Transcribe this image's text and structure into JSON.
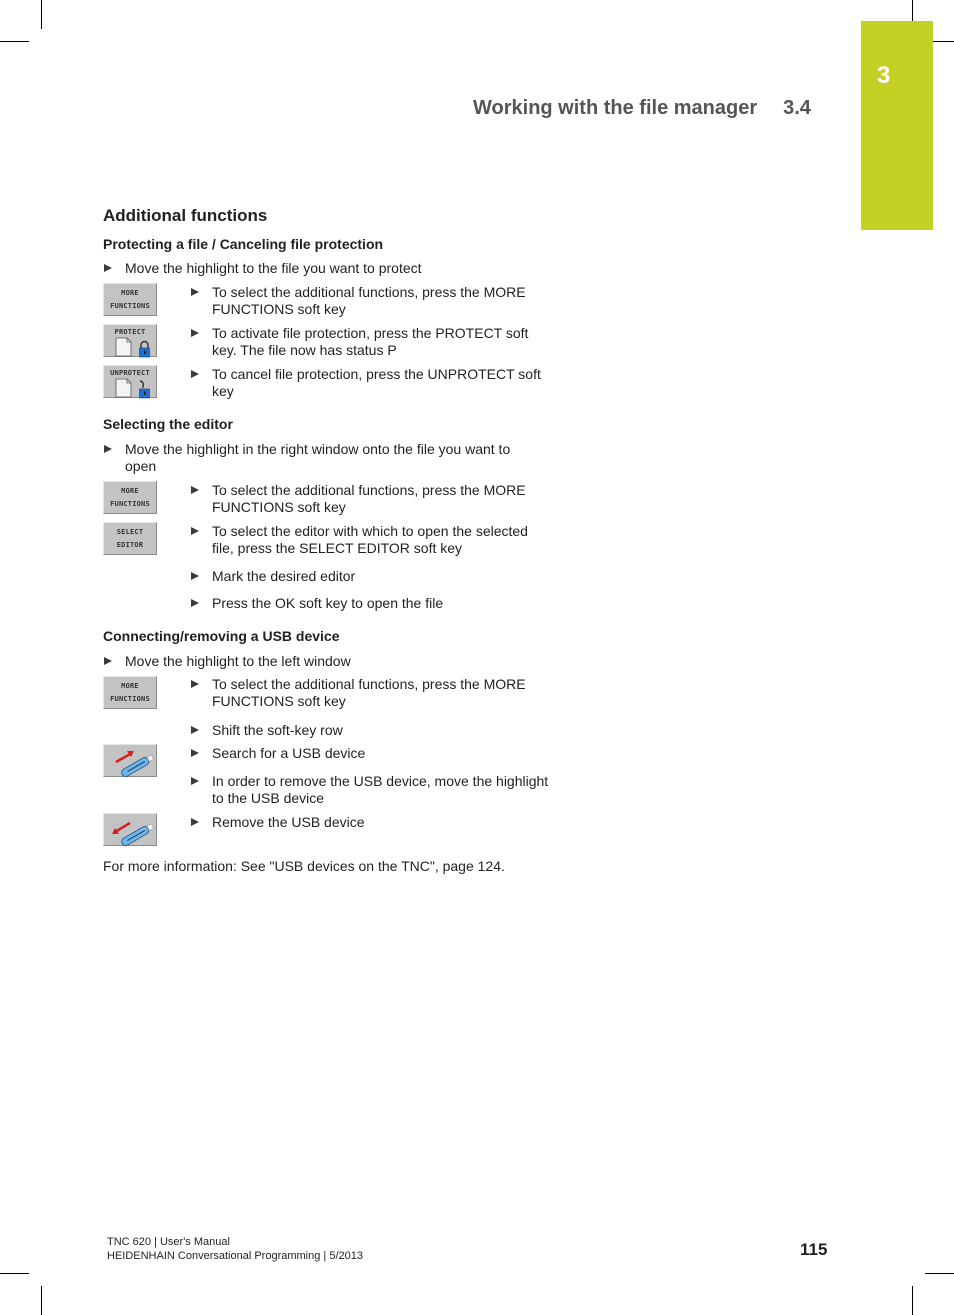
{
  "chapter_tab": {
    "number": "3",
    "color": "#c5d024"
  },
  "running_header": {
    "title": "Working with the file manager",
    "section": "3.4"
  },
  "section_title": "Additional functions",
  "protect": {
    "heading": "Protecting a file / Canceling file protection",
    "intro": "Move the highlight to the file you want to protect",
    "steps": [
      {
        "softkey": {
          "line1": "MORE",
          "line2": "FUNCTIONS"
        },
        "text": "To select the additional functions, press the MORE FUNCTIONS soft key"
      },
      {
        "softkey": {
          "line1": "PROTECT",
          "icon": "file-locked-icon"
        },
        "text": "To activate file protection, press the PROTECT soft key. The file now has status P"
      },
      {
        "softkey": {
          "line1": "UNPROTECT",
          "icon": "file-unlocked-icon"
        },
        "text": "To cancel file protection, press the UNPROTECT soft key"
      }
    ]
  },
  "editor": {
    "heading": "Selecting the editor",
    "intro": "Move the highlight in the right window onto the file you want to open",
    "steps": [
      {
        "softkey": {
          "line1": "MORE",
          "line2": "FUNCTIONS"
        },
        "text": "To select the additional functions, press the MORE FUNCTIONS soft key"
      },
      {
        "softkey": {
          "line1": "SELECT",
          "line2": "EDITOR"
        },
        "text": "To select the editor with which to open the selected file, press the SELECT EDITOR soft key"
      },
      {
        "text": "Mark the desired editor"
      },
      {
        "text": "Press the OK soft key to open the file"
      }
    ]
  },
  "usb": {
    "heading": "Connecting/removing a USB device",
    "intro": "Move the highlight to the left window",
    "steps": [
      {
        "softkey": {
          "line1": "MORE",
          "line2": "FUNCTIONS"
        },
        "text": "To select the additional functions, press the MORE FUNCTIONS soft key"
      },
      {
        "text": "Shift the soft-key row"
      },
      {
        "softkey": {
          "icon": "usb-connect-icon"
        },
        "text": "Search for a USB device"
      },
      {
        "text": "In order to remove the USB device, move the highlight to the USB device"
      },
      {
        "softkey": {
          "icon": "usb-remove-icon"
        },
        "text": "Remove the USB device"
      }
    ]
  },
  "more_info": "For more information: See \"USB devices on the TNC\", page 124.",
  "footer": {
    "line1": "TNC 620 | User's Manual",
    "line2": "HEIDENHAIN Conversational Programming | 5/2013",
    "page_number": "115"
  }
}
